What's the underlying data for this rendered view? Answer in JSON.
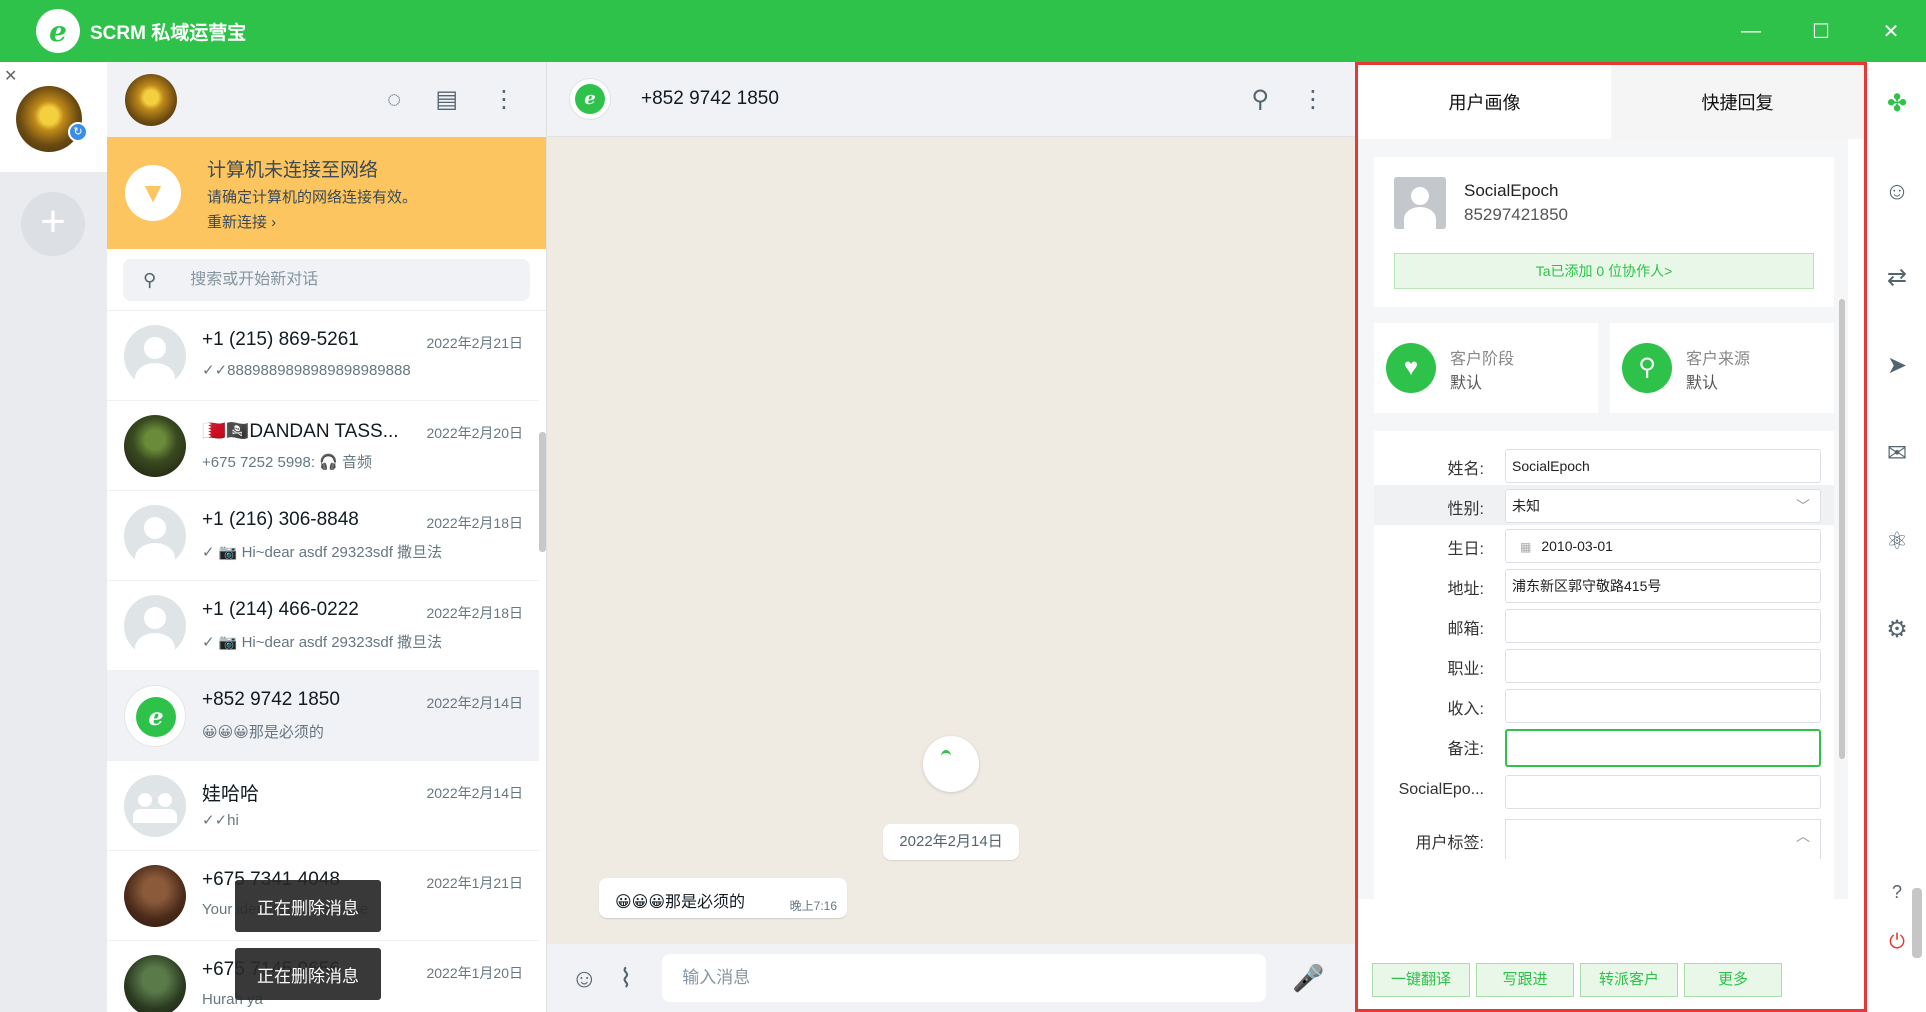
{
  "app": {
    "title": "SCRM 私域运营宝",
    "logo_letter": "e",
    "brand_color": "#2ec24a"
  },
  "window_controls": {
    "minimize": "—",
    "maximize": "☐",
    "close": "✕"
  },
  "account_column": {
    "close_symbol": "✕",
    "badge_symbol": "↻",
    "add_symbol": "+"
  },
  "chat_list": {
    "offline_banner": {
      "title": "计算机未连接至网络",
      "subtitle": "请确定计算机的网络连接有效。",
      "action": "重新连接 ›"
    },
    "search_placeholder": "搜索或开始新对话",
    "chats": [
      {
        "name": "+1 (215) 869-5261",
        "date": "2022年2月21日",
        "preview": "✓✓8889889898989898989888",
        "avatar": "default"
      },
      {
        "name": "🇧🇭🏴‍☠️DANDAN TASS...",
        "date": "2022年2月20日",
        "preview": "+675 7252 5998: 🎧 音频",
        "avatar": "photo"
      },
      {
        "name": "+1 (216) 306-8848",
        "date": "2022年2月18日",
        "preview": "✓ 📷 Hi~dear asdf 29323sdf 撒旦法",
        "avatar": "default"
      },
      {
        "name": "+1 (214) 466-0222",
        "date": "2022年2月18日",
        "preview": "✓ 📷 Hi~dear asdf 29323sdf 撒旦法",
        "avatar": "default"
      },
      {
        "name": "+852 9742 1850",
        "date": "2022年2月14日",
        "preview": "😀😀😀那是必须的",
        "avatar": "brand"
      },
      {
        "name": "娃哈哈",
        "date": "2022年2月14日",
        "preview": "✓✓hi",
        "avatar": "group"
      },
      {
        "name": "+675 7341 4048",
        "date": "2022年1月21日",
        "preview": "Your identification please",
        "avatar": "brown"
      },
      {
        "name": "+675 7145 9656",
        "date": "2022年1月20日",
        "preview": "Hurah ya",
        "avatar": "green"
      }
    ],
    "deleting_toasts": [
      "正在删除消息",
      "正在删除消息"
    ]
  },
  "conversation": {
    "contact_name": "+852 9742 1850",
    "date_chip": "2022年2月14日",
    "message": {
      "text": "😀😀😀那是必须的",
      "time": "晚上7:16"
    },
    "composer_placeholder": "输入消息"
  },
  "profile_panel": {
    "tabs": [
      "用户画像",
      "快捷回复"
    ],
    "active_tab": "用户画像",
    "name": "SocialEpoch",
    "phone": "85297421850",
    "collaborators": "Ta已添加 0 位协作人>",
    "stage": {
      "title": "客户阶段",
      "value": "默认"
    },
    "source": {
      "title": "客户来源",
      "value": "默认"
    },
    "fields": {
      "name_label": "姓名:",
      "name_value": "SocialEpoch",
      "gender_label": "性别:",
      "gender_value": "未知",
      "birthday_label": "生日:",
      "birthday_value": "2010-03-01",
      "address_label": "地址:",
      "address_value": "浦东新区郭守敬路415号",
      "email_label": "邮箱:",
      "email_value": "",
      "job_label": "职业:",
      "job_value": "",
      "income_label": "收入:",
      "income_value": "",
      "note_label": "备注:",
      "note_value": "",
      "custom_label": "SocialEpo...",
      "custom_value": "",
      "tags_label": "用户标签:"
    },
    "actions": [
      "一键翻译",
      "写跟进",
      "转派客户",
      "更多"
    ]
  },
  "highlight_color": "#e53935"
}
